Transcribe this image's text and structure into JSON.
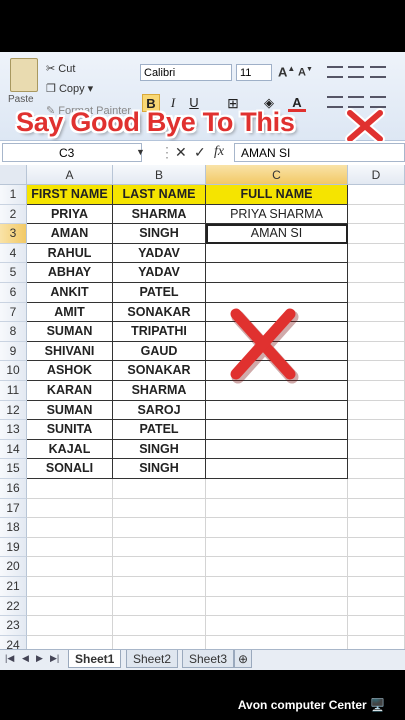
{
  "ribbon": {
    "paste_label": "Paste",
    "cut_label": "Cut",
    "copy_label": "Copy ▾",
    "format_painter_label": "Format Painter",
    "font_name": "Calibri",
    "font_size": "11",
    "bold": "B",
    "italic": "I",
    "underline": "U"
  },
  "banner": {
    "text": "Say Good Bye To This"
  },
  "formula_bar": {
    "name_box": "C3",
    "fx_label": "fx",
    "value": "AMAN SI"
  },
  "columns": [
    "A",
    "B",
    "C",
    "D"
  ],
  "rows": [
    "1",
    "2",
    "3",
    "4",
    "5",
    "6",
    "7",
    "8",
    "9",
    "10",
    "11",
    "12",
    "13",
    "14",
    "15",
    "16",
    "17",
    "18",
    "19",
    "20",
    "21",
    "22",
    "23",
    "24"
  ],
  "headers": {
    "first_name": "FIRST NAME",
    "last_name": "LAST NAME",
    "full_name": "FULL NAME"
  },
  "data": [
    {
      "first": "PRIYA",
      "last": "SHARMA",
      "full": "PRIYA SHARMA"
    },
    {
      "first": "AMAN",
      "last": "SINGH",
      "full": "AMAN SI"
    },
    {
      "first": "RAHUL",
      "last": "YADAV",
      "full": ""
    },
    {
      "first": "ABHAY",
      "last": "YADAV",
      "full": ""
    },
    {
      "first": "ANKIT",
      "last": "PATEL",
      "full": ""
    },
    {
      "first": "AMIT",
      "last": "SONAKAR",
      "full": ""
    },
    {
      "first": "SUMAN",
      "last": "TRIPATHI",
      "full": ""
    },
    {
      "first": "SHIVANI",
      "last": "GAUD",
      "full": ""
    },
    {
      "first": "ASHOK",
      "last": "SONAKAR",
      "full": ""
    },
    {
      "first": "KARAN",
      "last": "SHARMA",
      "full": ""
    },
    {
      "first": "SUMAN",
      "last": "SAROJ",
      "full": ""
    },
    {
      "first": "SUNITA",
      "last": "PATEL",
      "full": ""
    },
    {
      "first": "KAJAL",
      "last": "SINGH",
      "full": ""
    },
    {
      "first": "SONALI",
      "last": "SINGH",
      "full": ""
    }
  ],
  "sheets": [
    "Sheet1",
    "Sheet2",
    "Sheet3"
  ],
  "credit": "Avon computer Center 🖥️",
  "colors": {
    "header_fill": "#f5e400",
    "banner_text": "#e0312f",
    "x_mark": "#e0312f"
  }
}
